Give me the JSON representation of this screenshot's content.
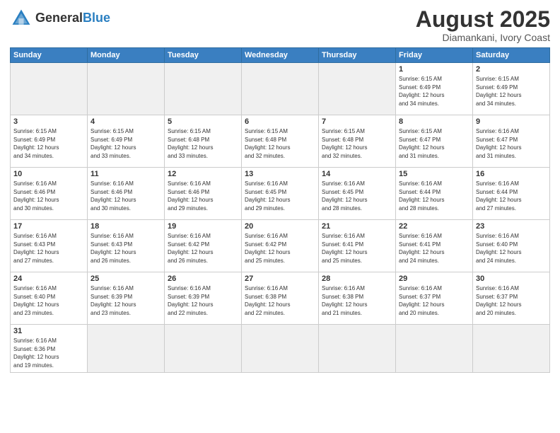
{
  "header": {
    "logo_general": "General",
    "logo_blue": "Blue",
    "title": "August 2025",
    "subtitle": "Diamankani, Ivory Coast"
  },
  "weekdays": [
    "Sunday",
    "Monday",
    "Tuesday",
    "Wednesday",
    "Thursday",
    "Friday",
    "Saturday"
  ],
  "weeks": [
    [
      {
        "day": "",
        "info": "",
        "empty": true
      },
      {
        "day": "",
        "info": "",
        "empty": true
      },
      {
        "day": "",
        "info": "",
        "empty": true
      },
      {
        "day": "",
        "info": "",
        "empty": true
      },
      {
        "day": "",
        "info": "",
        "empty": true
      },
      {
        "day": "1",
        "info": "Sunrise: 6:15 AM\nSunset: 6:49 PM\nDaylight: 12 hours\nand 34 minutes.",
        "empty": false
      },
      {
        "day": "2",
        "info": "Sunrise: 6:15 AM\nSunset: 6:49 PM\nDaylight: 12 hours\nand 34 minutes.",
        "empty": false
      }
    ],
    [
      {
        "day": "3",
        "info": "Sunrise: 6:15 AM\nSunset: 6:49 PM\nDaylight: 12 hours\nand 34 minutes.",
        "empty": false
      },
      {
        "day": "4",
        "info": "Sunrise: 6:15 AM\nSunset: 6:49 PM\nDaylight: 12 hours\nand 33 minutes.",
        "empty": false
      },
      {
        "day": "5",
        "info": "Sunrise: 6:15 AM\nSunset: 6:48 PM\nDaylight: 12 hours\nand 33 minutes.",
        "empty": false
      },
      {
        "day": "6",
        "info": "Sunrise: 6:15 AM\nSunset: 6:48 PM\nDaylight: 12 hours\nand 32 minutes.",
        "empty": false
      },
      {
        "day": "7",
        "info": "Sunrise: 6:15 AM\nSunset: 6:48 PM\nDaylight: 12 hours\nand 32 minutes.",
        "empty": false
      },
      {
        "day": "8",
        "info": "Sunrise: 6:15 AM\nSunset: 6:47 PM\nDaylight: 12 hours\nand 31 minutes.",
        "empty": false
      },
      {
        "day": "9",
        "info": "Sunrise: 6:16 AM\nSunset: 6:47 PM\nDaylight: 12 hours\nand 31 minutes.",
        "empty": false
      }
    ],
    [
      {
        "day": "10",
        "info": "Sunrise: 6:16 AM\nSunset: 6:46 PM\nDaylight: 12 hours\nand 30 minutes.",
        "empty": false
      },
      {
        "day": "11",
        "info": "Sunrise: 6:16 AM\nSunset: 6:46 PM\nDaylight: 12 hours\nand 30 minutes.",
        "empty": false
      },
      {
        "day": "12",
        "info": "Sunrise: 6:16 AM\nSunset: 6:46 PM\nDaylight: 12 hours\nand 29 minutes.",
        "empty": false
      },
      {
        "day": "13",
        "info": "Sunrise: 6:16 AM\nSunset: 6:45 PM\nDaylight: 12 hours\nand 29 minutes.",
        "empty": false
      },
      {
        "day": "14",
        "info": "Sunrise: 6:16 AM\nSunset: 6:45 PM\nDaylight: 12 hours\nand 28 minutes.",
        "empty": false
      },
      {
        "day": "15",
        "info": "Sunrise: 6:16 AM\nSunset: 6:44 PM\nDaylight: 12 hours\nand 28 minutes.",
        "empty": false
      },
      {
        "day": "16",
        "info": "Sunrise: 6:16 AM\nSunset: 6:44 PM\nDaylight: 12 hours\nand 27 minutes.",
        "empty": false
      }
    ],
    [
      {
        "day": "17",
        "info": "Sunrise: 6:16 AM\nSunset: 6:43 PM\nDaylight: 12 hours\nand 27 minutes.",
        "empty": false
      },
      {
        "day": "18",
        "info": "Sunrise: 6:16 AM\nSunset: 6:43 PM\nDaylight: 12 hours\nand 26 minutes.",
        "empty": false
      },
      {
        "day": "19",
        "info": "Sunrise: 6:16 AM\nSunset: 6:42 PM\nDaylight: 12 hours\nand 26 minutes.",
        "empty": false
      },
      {
        "day": "20",
        "info": "Sunrise: 6:16 AM\nSunset: 6:42 PM\nDaylight: 12 hours\nand 25 minutes.",
        "empty": false
      },
      {
        "day": "21",
        "info": "Sunrise: 6:16 AM\nSunset: 6:41 PM\nDaylight: 12 hours\nand 25 minutes.",
        "empty": false
      },
      {
        "day": "22",
        "info": "Sunrise: 6:16 AM\nSunset: 6:41 PM\nDaylight: 12 hours\nand 24 minutes.",
        "empty": false
      },
      {
        "day": "23",
        "info": "Sunrise: 6:16 AM\nSunset: 6:40 PM\nDaylight: 12 hours\nand 24 minutes.",
        "empty": false
      }
    ],
    [
      {
        "day": "24",
        "info": "Sunrise: 6:16 AM\nSunset: 6:40 PM\nDaylight: 12 hours\nand 23 minutes.",
        "empty": false
      },
      {
        "day": "25",
        "info": "Sunrise: 6:16 AM\nSunset: 6:39 PM\nDaylight: 12 hours\nand 23 minutes.",
        "empty": false
      },
      {
        "day": "26",
        "info": "Sunrise: 6:16 AM\nSunset: 6:39 PM\nDaylight: 12 hours\nand 22 minutes.",
        "empty": false
      },
      {
        "day": "27",
        "info": "Sunrise: 6:16 AM\nSunset: 6:38 PM\nDaylight: 12 hours\nand 22 minutes.",
        "empty": false
      },
      {
        "day": "28",
        "info": "Sunrise: 6:16 AM\nSunset: 6:38 PM\nDaylight: 12 hours\nand 21 minutes.",
        "empty": false
      },
      {
        "day": "29",
        "info": "Sunrise: 6:16 AM\nSunset: 6:37 PM\nDaylight: 12 hours\nand 20 minutes.",
        "empty": false
      },
      {
        "day": "30",
        "info": "Sunrise: 6:16 AM\nSunset: 6:37 PM\nDaylight: 12 hours\nand 20 minutes.",
        "empty": false
      }
    ],
    [
      {
        "day": "31",
        "info": "Sunrise: 6:16 AM\nSunset: 6:36 PM\nDaylight: 12 hours\nand 19 minutes.",
        "empty": false
      },
      {
        "day": "",
        "info": "",
        "empty": true
      },
      {
        "day": "",
        "info": "",
        "empty": true
      },
      {
        "day": "",
        "info": "",
        "empty": true
      },
      {
        "day": "",
        "info": "",
        "empty": true
      },
      {
        "day": "",
        "info": "",
        "empty": true
      },
      {
        "day": "",
        "info": "",
        "empty": true
      }
    ]
  ]
}
